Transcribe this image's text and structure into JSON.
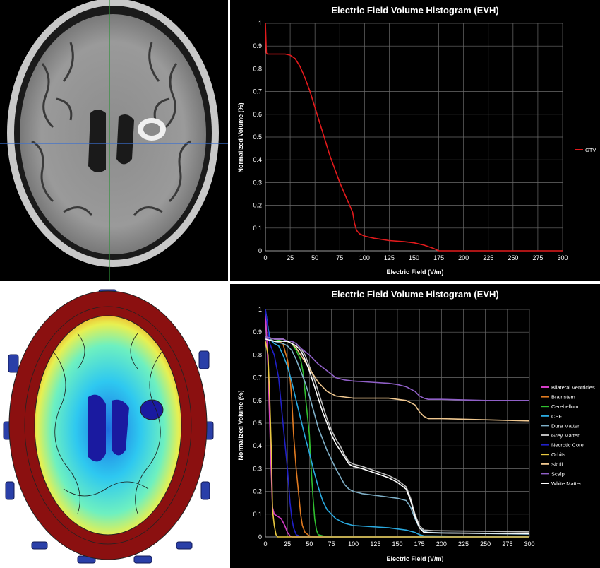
{
  "colors": {
    "background": "#000000",
    "gtv": "#e31a1c",
    "field_colormap": [
      "#1a1aa0",
      "#1e6fe0",
      "#2ec8f0",
      "#6ef0c0",
      "#e8f050",
      "#f0a020",
      "#d02818",
      "#8b1010"
    ]
  },
  "images": {
    "mri": {
      "type": "axial T1 MRI slice with crosshair",
      "crosshair_color": "#3a6fd0"
    },
    "field_map": {
      "type": "electric field distribution map with electrode arrays",
      "electrode_color": "#2a3fa8"
    }
  },
  "chart_data": [
    {
      "type": "line",
      "title": "Electric Field Volume Histogram (EVH)",
      "xlabel": "Electric Field (V/m)",
      "ylabel": "Normalized Volume (%)",
      "xlim": [
        0,
        300
      ],
      "ylim": [
        0,
        1
      ],
      "xticks": [
        0,
        25,
        50,
        75,
        100,
        125,
        150,
        175,
        200,
        225,
        250,
        275,
        300
      ],
      "yticks": [
        0,
        0.1,
        0.2,
        0.3,
        0.4,
        0.5,
        0.6,
        0.7,
        0.8,
        0.9,
        1
      ],
      "grid": true,
      "legend_position": "right",
      "series": [
        {
          "name": "GTV",
          "color": "#e31a1c",
          "x": [
            0,
            1,
            2,
            10,
            20,
            25,
            30,
            35,
            40,
            45,
            50,
            55,
            60,
            65,
            70,
            75,
            80,
            85,
            88,
            90,
            92,
            95,
            100,
            110,
            125,
            140,
            150,
            160,
            170,
            175,
            200,
            250,
            300
          ],
          "y": [
            1,
            0.87,
            0.865,
            0.865,
            0.865,
            0.86,
            0.845,
            0.81,
            0.76,
            0.7,
            0.63,
            0.56,
            0.49,
            0.42,
            0.36,
            0.3,
            0.25,
            0.2,
            0.17,
            0.12,
            0.09,
            0.075,
            0.065,
            0.055,
            0.045,
            0.04,
            0.035,
            0.025,
            0.01,
            0,
            0,
            0,
            0
          ]
        }
      ]
    },
    {
      "type": "line",
      "title": "Electric Field Volume Histogram (EVH)",
      "xlabel": "Electric Field (V/m)",
      "ylabel": "Normalized Volume (%)",
      "xlim": [
        0,
        300
      ],
      "ylim": [
        0,
        1
      ],
      "xticks": [
        0,
        25,
        50,
        75,
        100,
        125,
        150,
        175,
        200,
        225,
        250,
        275,
        300
      ],
      "yticks": [
        0,
        0.1,
        0.2,
        0.3,
        0.4,
        0.5,
        0.6,
        0.7,
        0.8,
        0.9,
        1
      ],
      "grid": true,
      "legend_position": "right",
      "series": [
        {
          "name": "Bilateral Ventricles",
          "color": "#d63cc8",
          "x": [
            0,
            3,
            6,
            8,
            10,
            14,
            18,
            22,
            25,
            28,
            30,
            40,
            300
          ],
          "y": [
            1,
            0.75,
            0.35,
            0.13,
            0.1,
            0.09,
            0.08,
            0.05,
            0.02,
            0.005,
            0,
            0,
            0
          ]
        },
        {
          "name": "Brainstem",
          "color": "#e07a20",
          "x": [
            0,
            5,
            10,
            15,
            20,
            22,
            25,
            28,
            30,
            32,
            35,
            38,
            40,
            42,
            45,
            50,
            55,
            300
          ],
          "y": [
            0.88,
            0.87,
            0.86,
            0.86,
            0.85,
            0.82,
            0.78,
            0.7,
            0.6,
            0.45,
            0.3,
            0.18,
            0.1,
            0.05,
            0.02,
            0.005,
            0,
            0
          ]
        },
        {
          "name": "Cerebellum",
          "color": "#30c030",
          "x": [
            0,
            10,
            20,
            25,
            30,
            35,
            40,
            43,
            46,
            50,
            52,
            54,
            56,
            58,
            60,
            65,
            70,
            300
          ],
          "y": [
            0.88,
            0.87,
            0.86,
            0.86,
            0.85,
            0.82,
            0.78,
            0.72,
            0.6,
            0.45,
            0.3,
            0.18,
            0.08,
            0.03,
            0.01,
            0.005,
            0,
            0
          ]
        },
        {
          "name": "CSF",
          "color": "#2aaae0",
          "x": [
            0,
            5,
            10,
            15,
            20,
            25,
            30,
            35,
            40,
            45,
            50,
            55,
            60,
            65,
            70,
            80,
            90,
            100,
            120,
            140,
            150,
            160,
            170,
            175,
            180,
            300
          ],
          "y": [
            1,
            0.87,
            0.85,
            0.84,
            0.8,
            0.75,
            0.68,
            0.6,
            0.52,
            0.44,
            0.37,
            0.29,
            0.22,
            0.16,
            0.12,
            0.08,
            0.06,
            0.05,
            0.045,
            0.04,
            0.035,
            0.03,
            0.02,
            0.01,
            0.005,
            0
          ]
        },
        {
          "name": "Dura Matter",
          "color": "#7fb0c8",
          "x": [
            0,
            5,
            10,
            20,
            25,
            30,
            35,
            40,
            45,
            50,
            55,
            60,
            70,
            80,
            90,
            95,
            100,
            110,
            130,
            150,
            160,
            165,
            170,
            175,
            180,
            185,
            200,
            250,
            300
          ],
          "y": [
            0.88,
            0.87,
            0.86,
            0.85,
            0.84,
            0.82,
            0.78,
            0.73,
            0.68,
            0.62,
            0.55,
            0.48,
            0.38,
            0.3,
            0.23,
            0.21,
            0.2,
            0.19,
            0.18,
            0.17,
            0.16,
            0.13,
            0.08,
            0.04,
            0.025,
            0.02,
            0.018,
            0.015,
            0.012
          ]
        },
        {
          "name": "Grey Matter",
          "color": "#bdbdbd",
          "x": [
            0,
            10,
            20,
            25,
            30,
            35,
            40,
            45,
            50,
            55,
            60,
            65,
            70,
            75,
            80,
            85,
            90,
            95,
            100,
            110,
            125,
            140,
            150,
            160,
            165,
            170,
            175,
            180,
            190,
            200,
            250,
            300
          ],
          "y": [
            0.88,
            0.87,
            0.87,
            0.86,
            0.86,
            0.85,
            0.83,
            0.8,
            0.75,
            0.7,
            0.64,
            0.58,
            0.52,
            0.47,
            0.43,
            0.4,
            0.36,
            0.33,
            0.32,
            0.31,
            0.29,
            0.27,
            0.25,
            0.22,
            0.17,
            0.1,
            0.05,
            0.03,
            0.028,
            0.027,
            0.025,
            0.022
          ]
        },
        {
          "name": "Necrotic Core",
          "color": "#2020c8",
          "x": [
            0,
            5,
            10,
            15,
            20,
            25,
            28,
            30,
            32,
            35,
            38,
            40,
            45,
            300
          ],
          "y": [
            1,
            0.85,
            0.8,
            0.7,
            0.5,
            0.3,
            0.15,
            0.08,
            0.04,
            0.01,
            0.005,
            0,
            0,
            0
          ]
        },
        {
          "name": "Orbits",
          "color": "#e8c840",
          "x": [
            0,
            3,
            5,
            7,
            8,
            10,
            12,
            14,
            300
          ],
          "y": [
            0.86,
            0.8,
            0.6,
            0.35,
            0.12,
            0.05,
            0.01,
            0,
            0
          ]
        },
        {
          "name": "Skull",
          "color": "#f0c890",
          "x": [
            0,
            10,
            20,
            25,
            30,
            35,
            40,
            45,
            50,
            55,
            60,
            65,
            70,
            80,
            90,
            100,
            120,
            140,
            150,
            160,
            170,
            175,
            180,
            185,
            200,
            250,
            300
          ],
          "y": [
            0.88,
            0.87,
            0.87,
            0.86,
            0.85,
            0.83,
            0.8,
            0.77,
            0.74,
            0.71,
            0.68,
            0.66,
            0.64,
            0.62,
            0.615,
            0.61,
            0.61,
            0.61,
            0.605,
            0.6,
            0.58,
            0.55,
            0.53,
            0.52,
            0.52,
            0.515,
            0.51
          ]
        },
        {
          "name": "Scalp",
          "color": "#9060c8",
          "x": [
            0,
            10,
            20,
            25,
            30,
            35,
            40,
            50,
            60,
            70,
            80,
            90,
            100,
            120,
            140,
            150,
            160,
            170,
            175,
            180,
            185,
            200,
            250,
            300
          ],
          "y": [
            0.88,
            0.87,
            0.87,
            0.86,
            0.86,
            0.85,
            0.83,
            0.8,
            0.76,
            0.73,
            0.7,
            0.69,
            0.685,
            0.68,
            0.675,
            0.67,
            0.66,
            0.64,
            0.62,
            0.61,
            0.605,
            0.605,
            0.6,
            0.6
          ]
        },
        {
          "name": "White Matter",
          "color": "#ffffff",
          "x": [
            0,
            10,
            20,
            25,
            30,
            35,
            40,
            45,
            50,
            55,
            60,
            65,
            70,
            75,
            80,
            85,
            90,
            95,
            100,
            110,
            125,
            140,
            150,
            160,
            165,
            170,
            175,
            180,
            190,
            200,
            250,
            300
          ],
          "y": [
            0.87,
            0.86,
            0.86,
            0.86,
            0.85,
            0.84,
            0.82,
            0.78,
            0.73,
            0.67,
            0.61,
            0.55,
            0.5,
            0.45,
            0.41,
            0.38,
            0.35,
            0.32,
            0.31,
            0.3,
            0.28,
            0.26,
            0.24,
            0.21,
            0.16,
            0.09,
            0.04,
            0.02,
            0.018,
            0.017,
            0.016,
            0.015
          ]
        }
      ]
    }
  ]
}
